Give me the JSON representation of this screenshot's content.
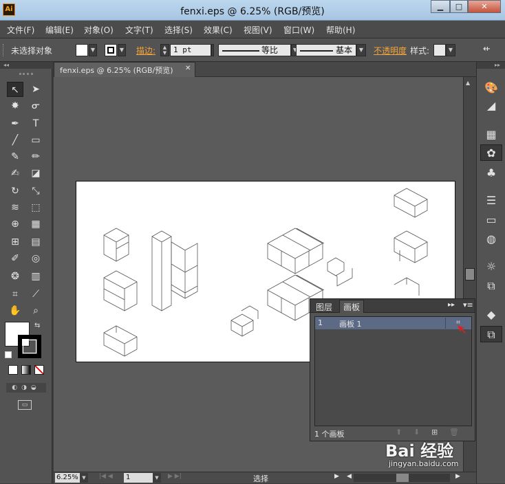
{
  "window": {
    "title": "fenxi.eps @ 6.25% (RGB/预览)",
    "app_logo": "Ai"
  },
  "menu": [
    "文件(F)",
    "编辑(E)",
    "对象(O)",
    "文字(T)",
    "选择(S)",
    "效果(C)",
    "视图(V)",
    "窗口(W)",
    "帮助(H)"
  ],
  "control_bar": {
    "selection_status": "未选择对象",
    "stroke_label": "描边:",
    "stroke_weight": "1 pt",
    "stroke_profile": "等比",
    "brush_style": "基本",
    "opacity_label": "不透明度",
    "style_label": "样式:"
  },
  "document_tab": {
    "title": "fenxi.eps @ 6.25% (RGB/预览)",
    "close": "✕"
  },
  "layers_panel": {
    "tabs": [
      "图层",
      "画板"
    ],
    "active_tab": "画板",
    "rows": [
      {
        "number": "1",
        "name": "画板 1"
      }
    ],
    "footer_count": "1 个画板"
  },
  "status_bar": {
    "zoom": "6.25%",
    "artboard_nav": "1",
    "status_text": "选择"
  },
  "watermark": {
    "brand": "Bai 经验",
    "url": "jingyan.baidu.com"
  },
  "colors": {
    "canvas": "#5b5b5b",
    "panel": "#535353",
    "accent_orange": "#f5a53a",
    "titlebar": "#b6d1ea"
  }
}
